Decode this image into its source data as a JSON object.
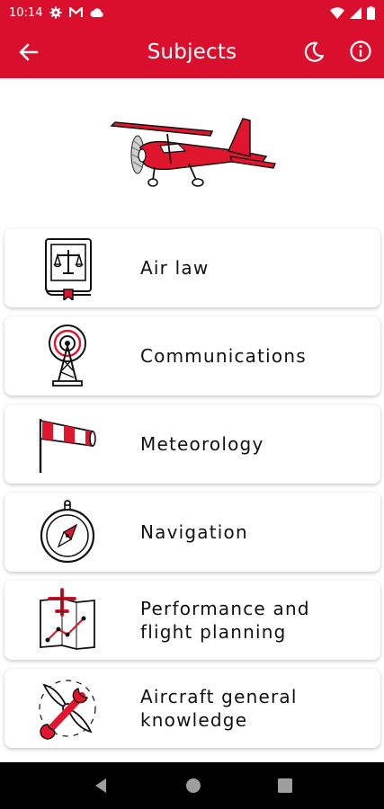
{
  "status_bar": {
    "time": "10:14",
    "icons": [
      "gear-icon",
      "gmail-icon",
      "cloud-icon",
      "wifi-icon",
      "signal-icon",
      "battery-icon"
    ]
  },
  "app_bar": {
    "title": "Subjects",
    "icons": [
      "back-arrow-icon",
      "dark-mode-moon-icon",
      "info-icon"
    ]
  },
  "hero_image": "red-airplane-illustration",
  "subjects": [
    {
      "label": "Air law",
      "icon": "law-book-scales-icon"
    },
    {
      "label": "Communications",
      "icon": "radio-tower-icon"
    },
    {
      "label": "Meteorology",
      "icon": "windsock-icon"
    },
    {
      "label": "Navigation",
      "icon": "compass-icon"
    },
    {
      "label": "Performance and\nflight planning",
      "icon": "flight-plan-chart-icon"
    },
    {
      "label": "Aircraft general\nknowledge",
      "icon": "propeller-wrench-icon"
    }
  ],
  "nav_bar": {
    "icons": [
      "back-triangle-icon",
      "home-circle-icon",
      "recents-square-icon"
    ]
  },
  "colors": {
    "primary": "#d90f2d",
    "accent_red": "#e0162e",
    "text": "#111111"
  }
}
